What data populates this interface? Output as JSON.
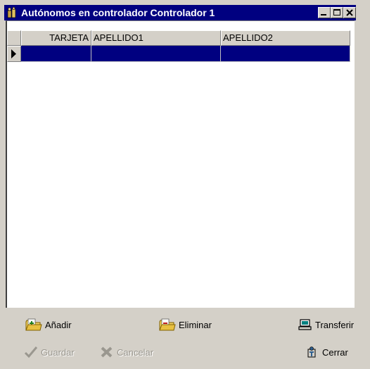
{
  "window": {
    "title": "Autónomos en controlador Controlador 1",
    "controls": [
      "minimize",
      "maximize",
      "close"
    ]
  },
  "grid": {
    "columns": [
      "TARJETA",
      "APELLIDO1",
      "APELLIDO2"
    ],
    "rows": [
      [
        "",
        "",
        ""
      ]
    ],
    "selected_row": 0,
    "selection_color": "#000080"
  },
  "toolbar_top": {
    "add_label": "Añadir",
    "delete_label": "Eliminar",
    "transfer_label": "Transferir"
  },
  "toolbar_bottom": {
    "save_label": "Guardar",
    "save_enabled": false,
    "cancel_label": "Cancelar",
    "cancel_enabled": false,
    "close_label": "Cerrar"
  },
  "colors": {
    "title_bar": "#000080",
    "face": "#d4d0c8"
  }
}
